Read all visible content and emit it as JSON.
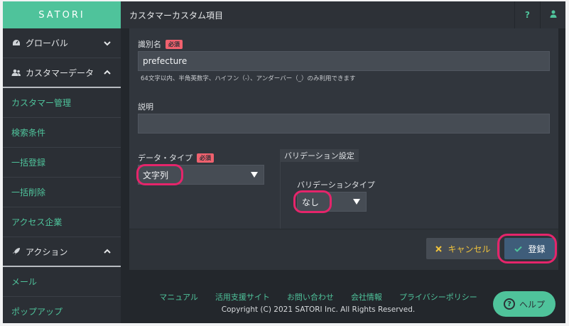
{
  "brand": {
    "logo_text": "SATORI",
    "accent": "#4fc39b"
  },
  "sidebar": {
    "groups": [
      {
        "label": "グローバル",
        "icon": "dashboard-icon",
        "expanded": false
      },
      {
        "label": "カスタマーデータ",
        "icon": "users-icon",
        "expanded": true
      },
      {
        "label": "アクション",
        "icon": "rocket-icon",
        "expanded": true
      }
    ],
    "customer_items": [
      "カスタマー管理",
      "検索条件",
      "一括登録",
      "一括削除",
      "アクセス企業"
    ],
    "action_items": [
      "メール",
      "ポップアップ"
    ]
  },
  "header": {
    "title": "カスタマーカスタム項目",
    "help_label": "?"
  },
  "form": {
    "identifier": {
      "label": "識別名",
      "required": "必須",
      "value": "prefecture",
      "hint": "64文字以内、半角英数字、ハイフン（-）、アンダーバー（_）のみ利用できます"
    },
    "description": {
      "label": "説明",
      "value": ""
    },
    "data_type": {
      "label": "データ・タイプ",
      "required": "必須",
      "value": "文字列"
    },
    "validation": {
      "section_title": "バリデーション設定",
      "type_label": "バリデーションタイプ",
      "type_value": "なし"
    }
  },
  "actions": {
    "cancel_label": "キャンセル",
    "register_label": "登録"
  },
  "footer": {
    "links": [
      "マニュアル",
      "活用支援サイト",
      "お問い合わせ",
      "会社情報",
      "プライバシーポリシー"
    ],
    "copyright": "Copyright (C) 2021 SATORI Inc. All Rights Reserved."
  },
  "help_button": {
    "label": "ヘルプ",
    "icon_text": "?"
  }
}
